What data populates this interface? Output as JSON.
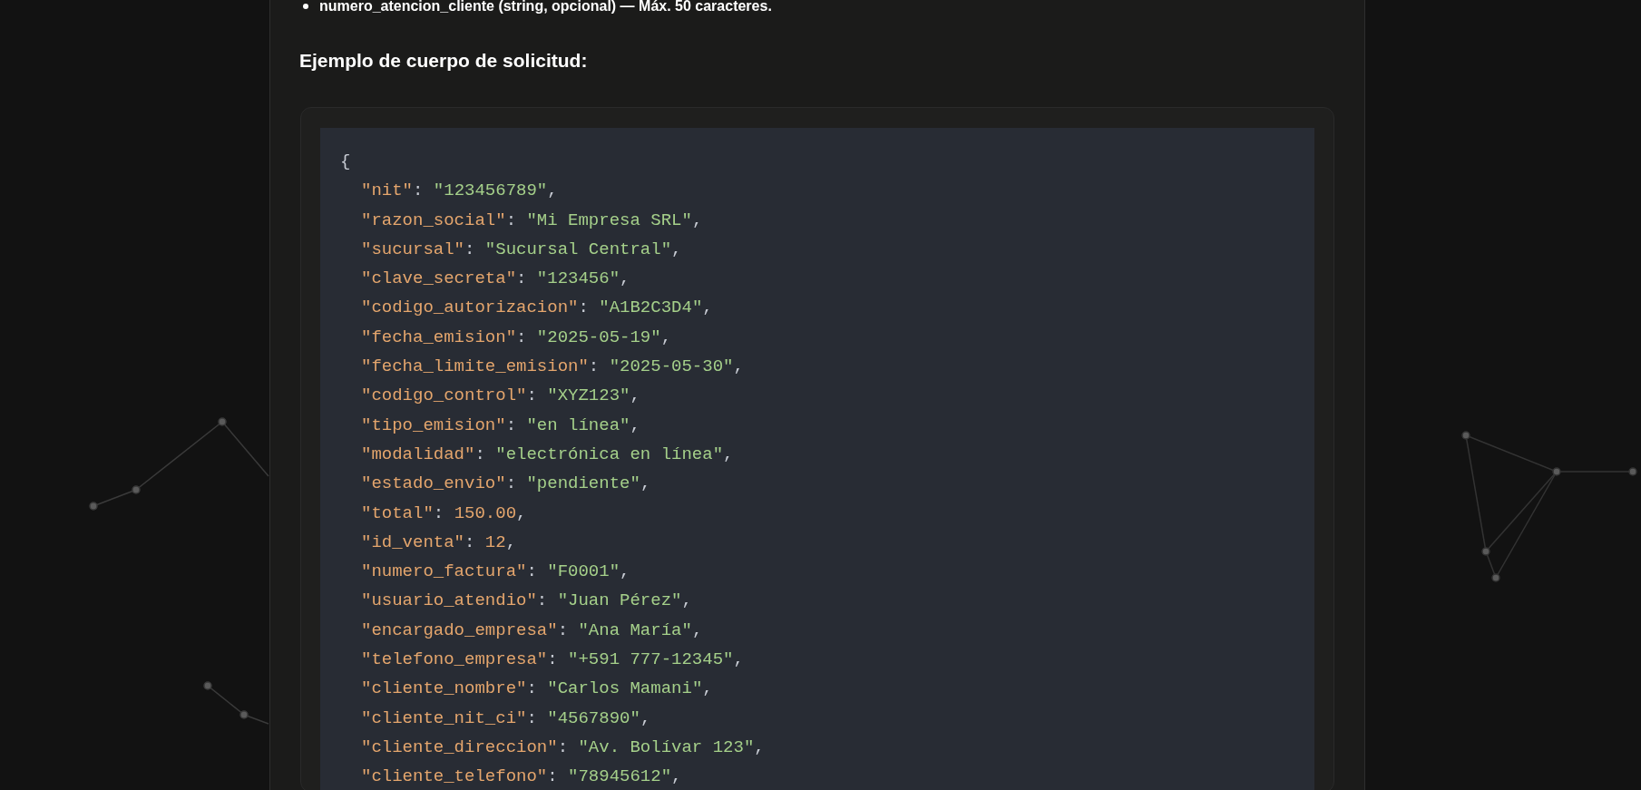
{
  "bullet_item": "numero_atencion_cliente (string, opcional) — Máx. 50 caracteres.",
  "heading": "Ejemplo de cuerpo de solicitud:",
  "code_block": {
    "open": "{",
    "key_separator": ":",
    "line_end": ",",
    "lines": [
      {
        "key": "\"nit\"",
        "value": "\"123456789\"",
        "kind": "string"
      },
      {
        "key": "\"razon_social\"",
        "value": "\"Mi Empresa SRL\"",
        "kind": "string"
      },
      {
        "key": "\"sucursal\"",
        "value": "\"Sucursal Central\"",
        "kind": "string"
      },
      {
        "key": "\"clave_secreta\"",
        "value": "\"123456\"",
        "kind": "string"
      },
      {
        "key": "\"codigo_autorizacion\"",
        "value": "\"A1B2C3D4\"",
        "kind": "string"
      },
      {
        "key": "\"fecha_emision\"",
        "value": "\"2025-05-19\"",
        "kind": "string"
      },
      {
        "key": "\"fecha_limite_emision\"",
        "value": "\"2025-05-30\"",
        "kind": "string"
      },
      {
        "key": "\"codigo_control\"",
        "value": "\"XYZ123\"",
        "kind": "string"
      },
      {
        "key": "\"tipo_emision\"",
        "value": "\"en línea\"",
        "kind": "string"
      },
      {
        "key": "\"modalidad\"",
        "value": "\"electrónica en línea\"",
        "kind": "string"
      },
      {
        "key": "\"estado_envio\"",
        "value": "\"pendiente\"",
        "kind": "string"
      },
      {
        "key": "\"total\"",
        "value": "150.00",
        "kind": "number"
      },
      {
        "key": "\"id_venta\"",
        "value": "12",
        "kind": "number"
      },
      {
        "key": "\"numero_factura\"",
        "value": "\"F0001\"",
        "kind": "string"
      },
      {
        "key": "\"usuario_atendio\"",
        "value": "\"Juan Pérez\"",
        "kind": "string"
      },
      {
        "key": "\"encargado_empresa\"",
        "value": "\"Ana María\"",
        "kind": "string"
      },
      {
        "key": "\"telefono_empresa\"",
        "value": "\"+591 777-12345\"",
        "kind": "string"
      },
      {
        "key": "\"cliente_nombre\"",
        "value": "\"Carlos Mamani\"",
        "kind": "string"
      },
      {
        "key": "\"cliente_nit_ci\"",
        "value": "\"4567890\"",
        "kind": "string"
      },
      {
        "key": "\"cliente_direccion\"",
        "value": "\"Av. Bolívar 123\"",
        "kind": "string"
      },
      {
        "key": "\"cliente_telefono\"",
        "value": "\"78945612\"",
        "kind": "string"
      }
    ]
  }
}
